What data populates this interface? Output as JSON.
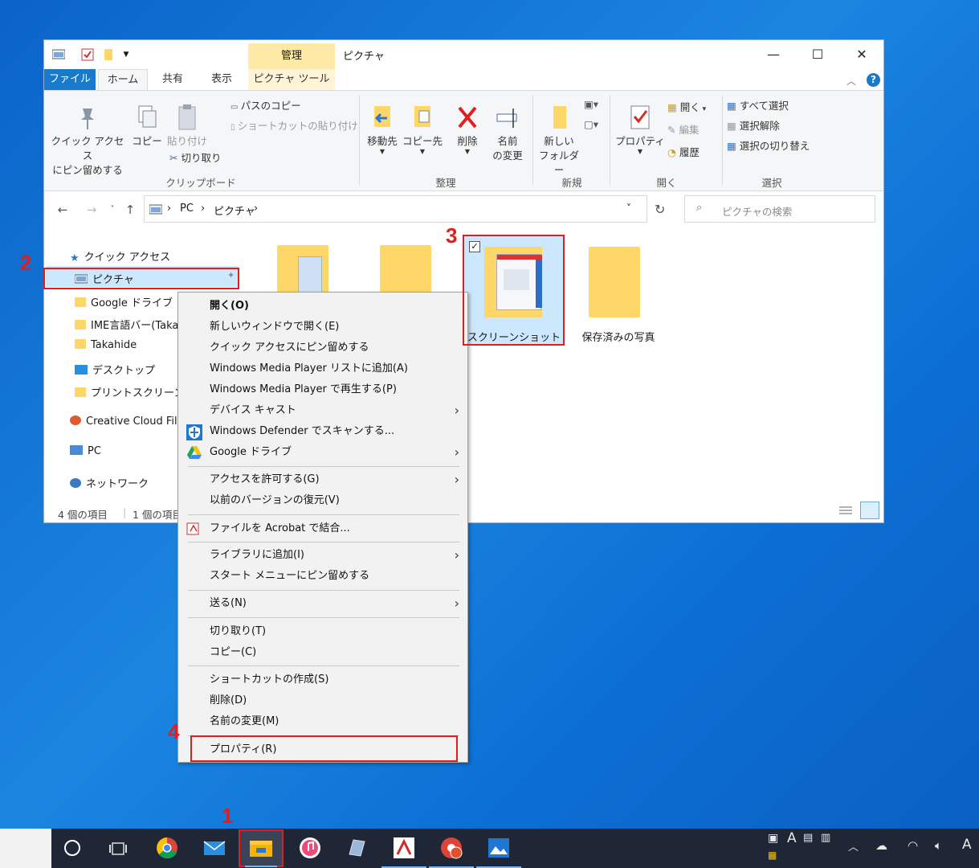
{
  "window": {
    "title": "ピクチャ",
    "context_header": "管理",
    "controls": {
      "minimize": "—",
      "maximize": "☐",
      "close": "✕"
    }
  },
  "tabs": {
    "file": "ファイル",
    "home": "ホーム",
    "share": "共有",
    "view": "表示",
    "picture_tools": "ピクチャ ツール"
  },
  "ribbon": {
    "pin_quick_access": [
      "クイック アクセス",
      "にピン留めする"
    ],
    "copy": "コピー",
    "paste": "貼り付け",
    "copy_path": "パスのコピー",
    "paste_shortcut": "ショートカットの貼り付け",
    "cut": "切り取り",
    "clipboard_group": "クリップボード",
    "move_to": "移動先",
    "copy_to": "コピー先",
    "delete": "削除",
    "rename": [
      "名前",
      "の変更"
    ],
    "organize_group": "整理",
    "new_folder": [
      "新しい",
      "フォルダー"
    ],
    "new_group": "新規",
    "properties": "プロパティ",
    "open": "開く",
    "edit": "編集",
    "history": "履歴",
    "open_group": "開く",
    "select_all": "すべて選択",
    "select_none": "選択解除",
    "invert_selection": "選択の切り替え",
    "select_group": "選択"
  },
  "address": {
    "crumbs": [
      "PC",
      "ピクチャ"
    ],
    "search_placeholder": "ピクチャの検索"
  },
  "nav": {
    "quick_access": "クイック アクセス",
    "pictures": "ピクチャ",
    "google_drive": "Google ドライブ",
    "ime": "IME言語バー(Taka",
    "takahide": "Takahide",
    "desktop": "デスクトップ",
    "printscreen": "プリントスクリーン(Ta",
    "creative_cloud": "Creative Cloud File",
    "pc": "PC",
    "network": "ネットワーク"
  },
  "status": {
    "items": "4 個の項目",
    "selected": "1 個の項目"
  },
  "folders": {
    "screenshots": "スクリーンショット",
    "saved_pictures": "保存済みの写真"
  },
  "context_menu": {
    "open": "開く(O)",
    "open_new_window": "新しいウィンドウで開く(E)",
    "pin_quick_access": "クイック アクセスにピン留めする",
    "wmp_add": "Windows Media Player リストに追加(A)",
    "wmp_play": "Windows Media Player で再生する(P)",
    "cast": "デバイス キャスト",
    "defender": "Windows Defender でスキャンする...",
    "google_drive": "Google ドライブ",
    "give_access": "アクセスを許可する(G)",
    "restore_prev": "以前のバージョンの復元(V)",
    "acrobat": "ファイルを Acrobat で結合...",
    "add_library": "ライブラリに追加(I)",
    "pin_start": "スタート メニューにピン留めする",
    "send_to": "送る(N)",
    "cut": "切り取り(T)",
    "copy": "コピー(C)",
    "create_shortcut": "ショートカットの作成(S)",
    "delete": "削除(D)",
    "rename": "名前の変更(M)",
    "properties": "プロパティ(R)"
  },
  "annotations": {
    "n1": "1",
    "n2": "2",
    "n3": "3",
    "n4": "4"
  },
  "taskbar": {
    "ime": "A"
  },
  "colors": {
    "accent": "#1979ca",
    "annotation": "#e11d1d",
    "folder": "#ffd769",
    "selection": "#cce8ff"
  }
}
